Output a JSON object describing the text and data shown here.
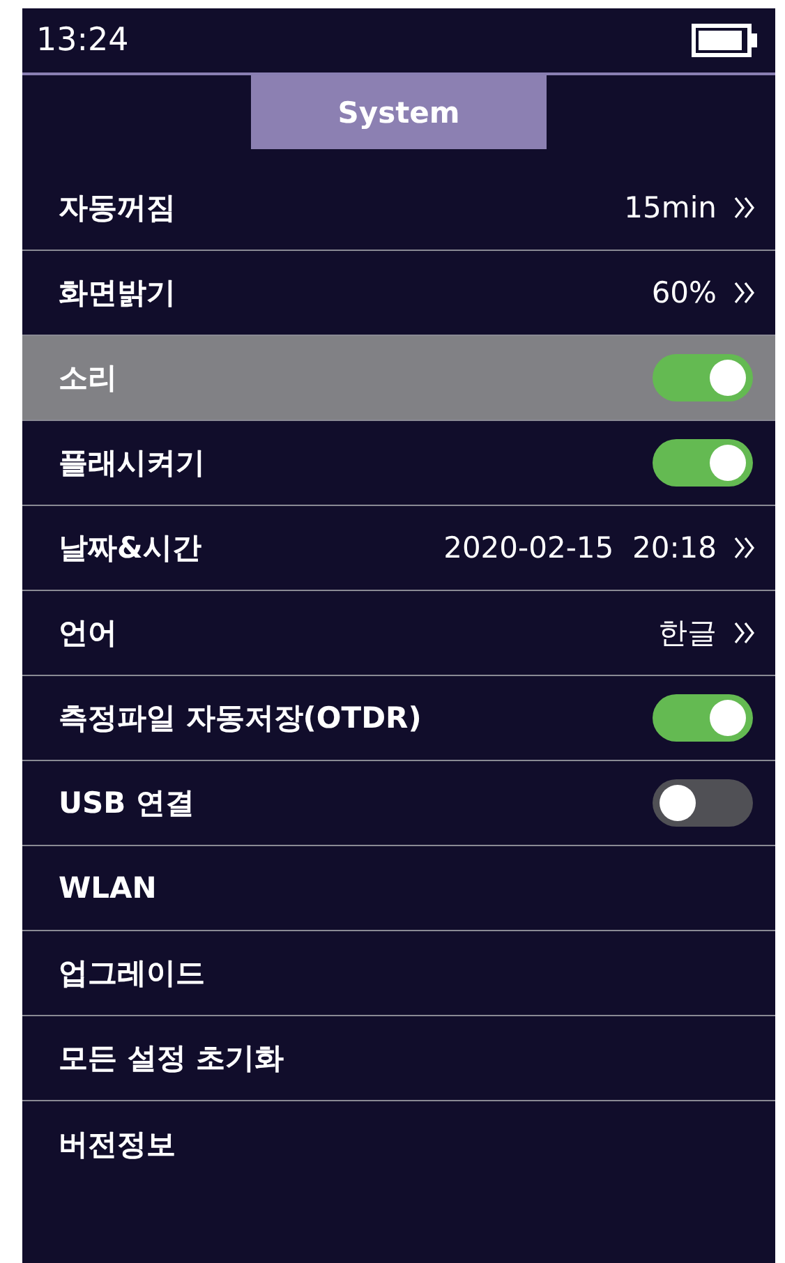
{
  "status_bar": {
    "time": "13:24"
  },
  "tabs": [
    {
      "label": "System",
      "selected": true
    }
  ],
  "settings": [
    {
      "label": "자동꺼짐",
      "kind": "value",
      "value": "15min",
      "selected": false
    },
    {
      "label": "화면밝기",
      "kind": "value",
      "value": "60%",
      "selected": false
    },
    {
      "label": "소리",
      "kind": "toggle",
      "on": true,
      "selected": true
    },
    {
      "label": "플래시켜기",
      "kind": "toggle",
      "on": true,
      "selected": false
    },
    {
      "label": "날짜&시간",
      "kind": "value",
      "value": "2020-02-15  20:18",
      "selected": false
    },
    {
      "label": "언어",
      "kind": "value",
      "value": "한글",
      "selected": false
    },
    {
      "label": "측정파일 자동저장(OTDR)",
      "kind": "toggle",
      "on": true,
      "selected": false
    },
    {
      "label": "USB  연결",
      "kind": "toggle",
      "on": false,
      "selected": false
    },
    {
      "label": "WLAN",
      "kind": "plain",
      "selected": false
    },
    {
      "label": "업그레이드",
      "kind": "plain",
      "selected": false
    },
    {
      "label": "모든 설정 초기화",
      "kind": "plain",
      "selected": false
    },
    {
      "label": "버전정보",
      "kind": "plain",
      "selected": false
    }
  ]
}
